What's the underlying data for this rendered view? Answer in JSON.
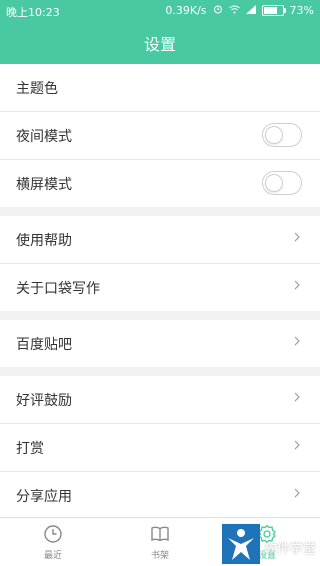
{
  "status_bar": {
    "time": "晚上10:23",
    "net_speed": "0.39K/s",
    "battery_percent": "73%",
    "battery_level": 0.73
  },
  "header": {
    "title": "设置"
  },
  "sections": [
    {
      "rows": [
        {
          "label": "主题色",
          "control": "none"
        },
        {
          "label": "夜间模式",
          "control": "toggle",
          "on": false
        },
        {
          "label": "横屏模式",
          "control": "toggle",
          "on": false
        }
      ]
    },
    {
      "rows": [
        {
          "label": "使用帮助",
          "control": "chevron"
        },
        {
          "label": "关于口袋写作",
          "control": "chevron"
        }
      ]
    },
    {
      "rows": [
        {
          "label": "百度贴吧",
          "control": "chevron"
        }
      ]
    },
    {
      "rows": [
        {
          "label": "好评鼓励",
          "control": "chevron"
        },
        {
          "label": "打赏",
          "control": "chevron"
        },
        {
          "label": "分享应用",
          "control": "chevron"
        }
      ]
    }
  ],
  "bottom_nav": {
    "tabs": [
      {
        "label": "最近",
        "icon": "clock-icon",
        "active": false
      },
      {
        "label": "书架",
        "icon": "book-icon",
        "active": false
      },
      {
        "label": "设置",
        "icon": "gear-icon",
        "active": true
      }
    ]
  },
  "watermark": {
    "text": "软件学堂"
  },
  "colors": {
    "accent": "#48c9a1",
    "watermark_logo": "#1f73b8"
  }
}
